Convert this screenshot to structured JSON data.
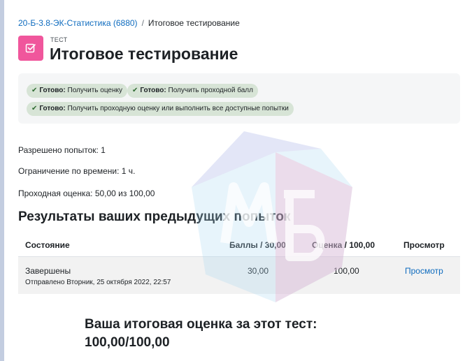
{
  "breadcrumb": {
    "course": "20-Б-3.8-ЭК-Статистика (6880)",
    "separator": "/",
    "current": "Итоговое тестирование"
  },
  "activity": {
    "type_label": "ТЕСТ",
    "title": "Итоговое тестирование",
    "icon": "quiz-checkbox-icon",
    "icon_color": "#f0569c"
  },
  "completion": {
    "items": [
      {
        "status": "Готово:",
        "text": "Получить оценку"
      },
      {
        "status": "Готово:",
        "text": "Получить проходной балл"
      },
      {
        "status": "Готово:",
        "text": "Получить проходную оценку или выполнить все доступные попытки"
      }
    ],
    "badge_color": "#d7e4d6"
  },
  "quiz_info": {
    "attempts_allowed": "Разрешено попыток: 1",
    "time_limit": "Ограничение по времени: 1 ч.",
    "passing_grade": "Проходная оценка: 50,00 из 100,00"
  },
  "results": {
    "title": "Результаты ваших предыдущих попыток",
    "headers": {
      "state": "Состояние",
      "marks": "Баллы / 30,00",
      "grade": "Оценка / 100,00",
      "review": "Просмотр"
    },
    "rows": [
      {
        "state": "Завершены",
        "submitted": "Отправлено Вторник, 25 октября 2022, 22:57",
        "marks": "30,00",
        "grade": "100,00",
        "review": "Просмотр"
      }
    ]
  },
  "final_grade": {
    "line1": "Ваша итоговая оценка за этот тест:",
    "line2": "100,00/100,00"
  },
  "colors": {
    "link": "#0f6cbf",
    "text": "#1d2125"
  }
}
